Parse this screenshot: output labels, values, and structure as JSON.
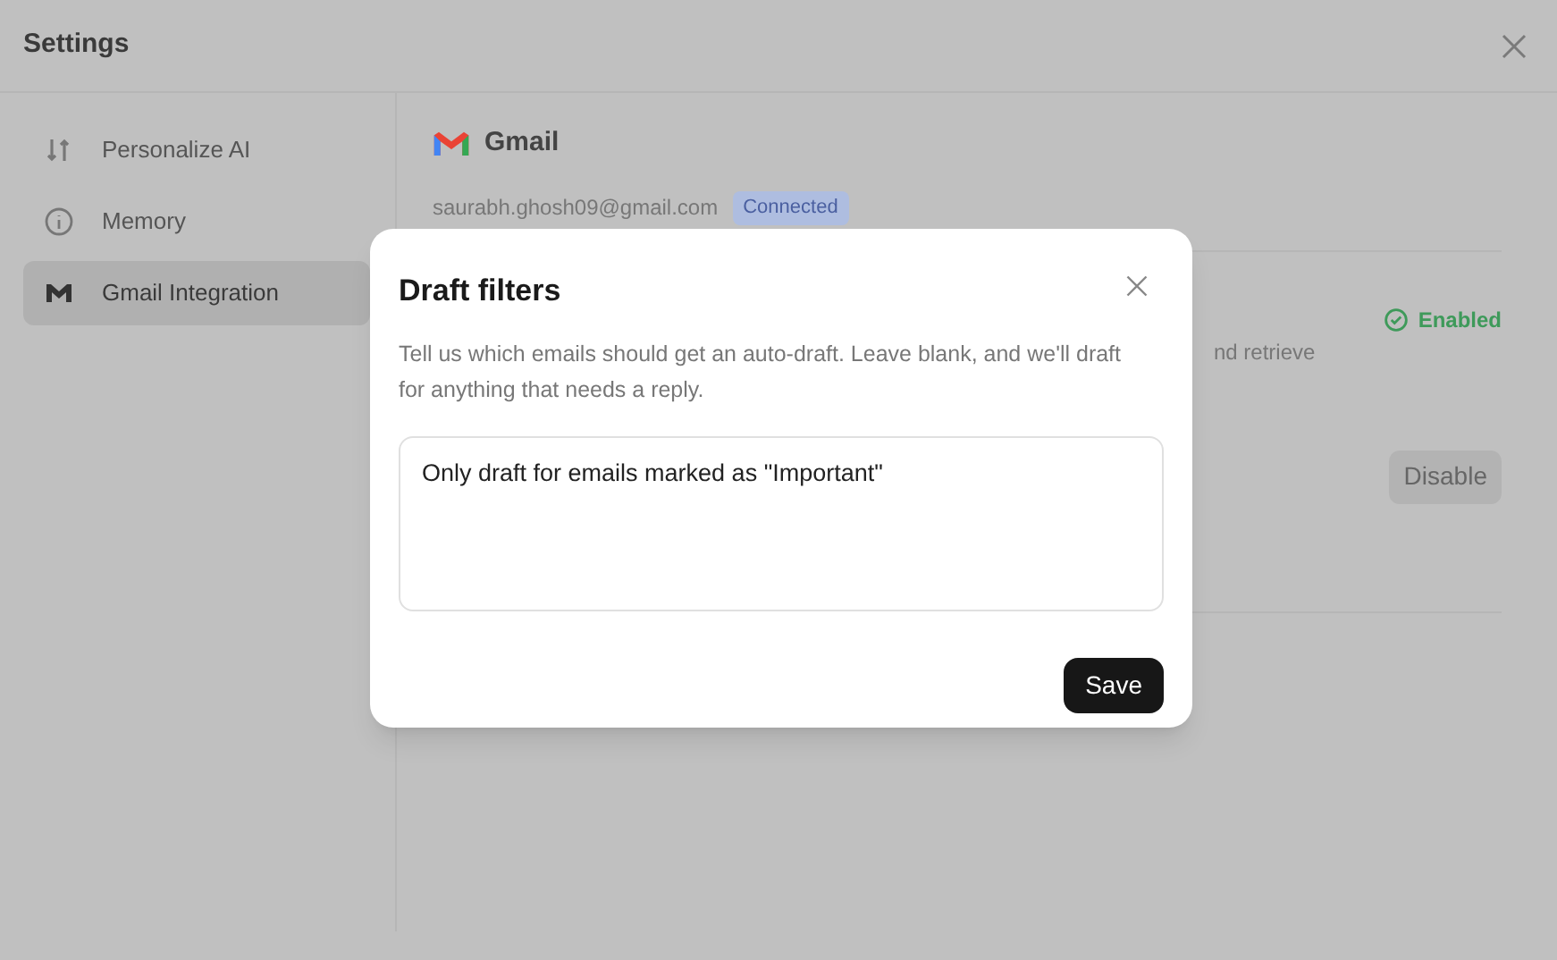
{
  "window": {
    "title": "Settings"
  },
  "sidebar": {
    "items": [
      {
        "label": "Personalize AI",
        "selected": false
      },
      {
        "label": "Memory",
        "selected": false
      },
      {
        "label": "Gmail Integration",
        "selected": true
      }
    ]
  },
  "content": {
    "title": "Gmail",
    "email": "saurabh.ghosh09@gmail.com",
    "badge": "Connected",
    "status": "Enabled",
    "description_fragment": "nd retrieve",
    "button": "Disable"
  },
  "dialog": {
    "title": "Draft filters",
    "description": "Tell us which emails should get an auto-draft. Leave blank, and we'll draft for anything that needs a reply.",
    "value": "Only draft for emails marked as \"Important\"",
    "button": "Save"
  }
}
